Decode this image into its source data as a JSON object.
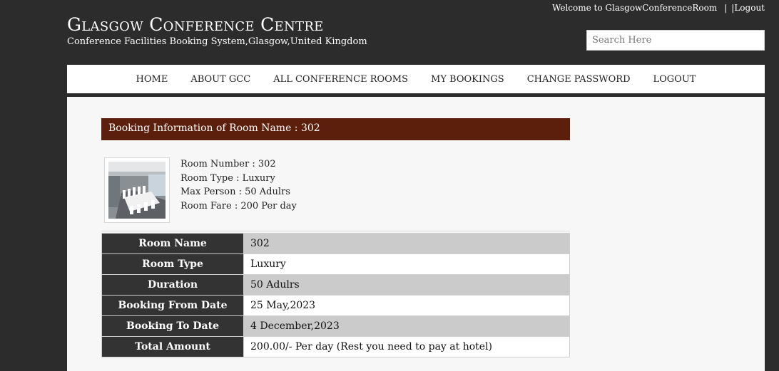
{
  "topbar": {
    "welcome": "Welcome to GlasgowConferenceRoom",
    "separator": "|",
    "logout": "|Logout"
  },
  "brand": {
    "title": "Glasgow Conference Centre",
    "subtitle": "Conference Facilities Booking System,Glasgow,United Kingdom"
  },
  "search": {
    "placeholder": "Search Here",
    "value": ""
  },
  "nav": {
    "items": [
      "HOME",
      "ABOUT GCC",
      "ALL CONFERENCE ROOMS",
      "MY BOOKINGS",
      "CHANGE PASSWORD",
      "LOGOUT"
    ]
  },
  "booking": {
    "section_title": "Booking Information of Room Name : 302",
    "room_info": [
      "Room Number : 302",
      "Room Type : Luxury",
      "Max Person : 50 Adulrs",
      "Room Fare : 200 Per day"
    ],
    "table": [
      {
        "label": "Room Name",
        "value": "302"
      },
      {
        "label": "Room Type",
        "value": "Luxury"
      },
      {
        "label": "Duration",
        "value": "50 Adulrs"
      },
      {
        "label": "Booking From Date",
        "value": "25 May,2023"
      },
      {
        "label": "Booking To Date",
        "value": "4 December,2023"
      },
      {
        "label": "Total Amount",
        "value": "200.00/- Per day (Rest you need to pay at hotel)"
      }
    ]
  }
}
